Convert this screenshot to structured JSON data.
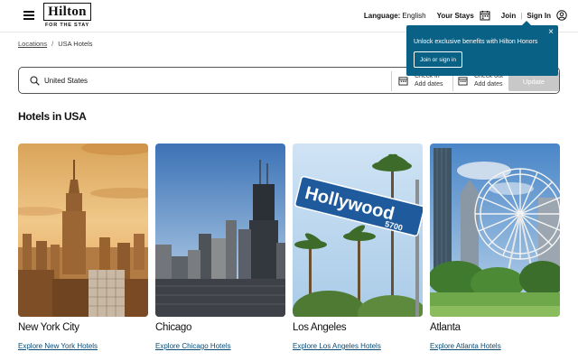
{
  "header": {
    "logo_text": "Hilton",
    "logo_tagline": "FOR THE STAY",
    "language_label": "Language:",
    "language_value": "English",
    "your_stays": "Your Stays",
    "join": "Join",
    "separator": "|",
    "sign_in": "Sign In"
  },
  "breadcrumb": {
    "items": [
      "Locations",
      "USA Hotels"
    ],
    "separator": "/"
  },
  "search": {
    "destination": "United States",
    "checkin_label": "Check-in",
    "checkin_value": "Add dates",
    "checkout_label": "Check-out",
    "checkout_value": "Add dates",
    "update_button": "Update"
  },
  "promo": {
    "message": "Unlock exclusive benefits with Hilton Honors",
    "button": "Join or sign in",
    "close": "×"
  },
  "section": {
    "title": "Hotels in USA"
  },
  "cards": [
    {
      "city": "New York City",
      "link": "Explore New York Hotels"
    },
    {
      "city": "Chicago",
      "link": "Explore Chicago Hotels"
    },
    {
      "city": "Los Angeles",
      "link": "Explore Los Angeles Hotels"
    },
    {
      "city": "Atlanta",
      "link": "Explore Atlanta Hotels"
    }
  ],
  "sign_text": {
    "street": "Hollywood",
    "number": "5700"
  },
  "colors": {
    "brand_blue": "#0a6186",
    "link_blue": "#0a4a73",
    "update_disabled": "#c8c8c8"
  },
  "icons": [
    "menu-icon",
    "calendar-icon",
    "user-icon",
    "search-icon",
    "close-icon"
  ]
}
